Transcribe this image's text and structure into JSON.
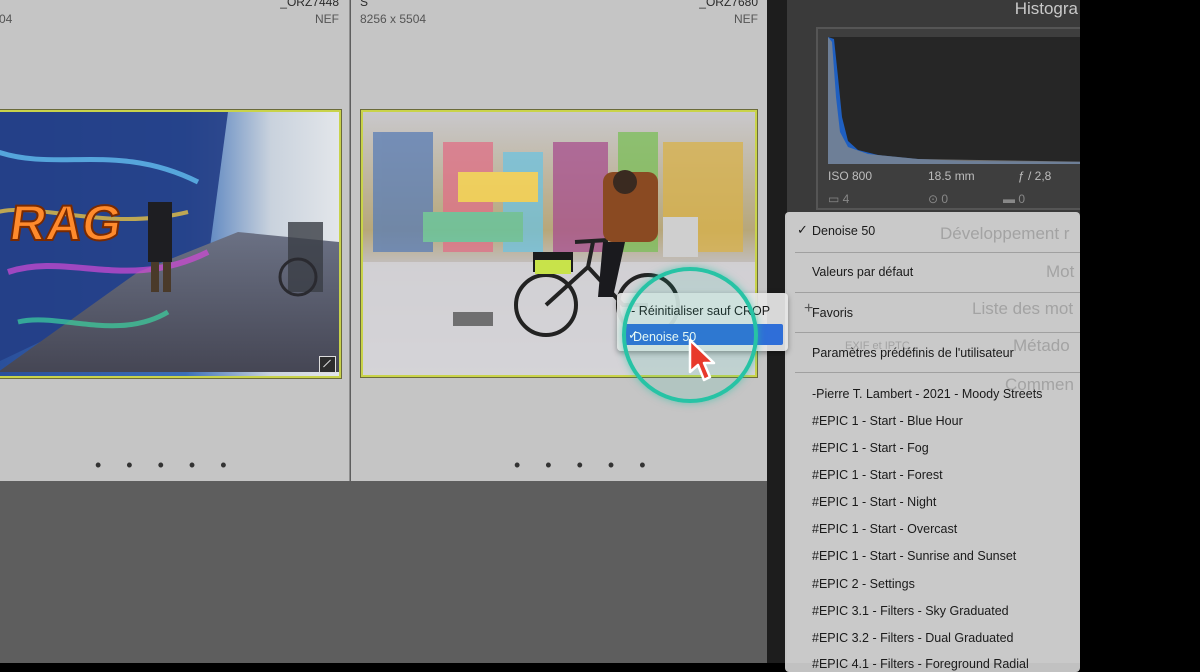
{
  "grid": {
    "cells": [
      {
        "name": "_ORZ7448",
        "format": "NEF",
        "dimensions": "04"
      },
      {
        "name": "_ORZ7680",
        "format": "NEF",
        "dimensions": "8256 x 5504",
        "prefix": "S"
      }
    ],
    "dots": "• • • • •"
  },
  "histogram": {
    "title": "Histogra",
    "iso": "ISO 800",
    "focal": "18.5 mm",
    "aperture": "ƒ / 2,8",
    "counts": [
      "4",
      "0",
      "0"
    ],
    "colors": {
      "blue": "#1f5fc0",
      "gray": "#8a8a8a"
    }
  },
  "panels": {
    "develop": "Développement r",
    "mots": "Mot",
    "liste_mots": "Liste des mot",
    "metadata": "Métado",
    "comments": "Commen",
    "exif_label": "EXIF et IPTC"
  },
  "presets_menu": {
    "selected": "Denoise 50",
    "items": [
      "Valeurs par défaut",
      "Favoris",
      "Paramètres prédéfinis de l'utilisateur",
      "-Pierre T. Lambert - 2021 - Moody Streets",
      "#EPIC 1 - Start - Blue Hour",
      "#EPIC 1 - Start - Fog",
      "#EPIC 1 - Start - Forest",
      "#EPIC 1 - Start - Night",
      "#EPIC 1 - Start - Overcast",
      "#EPIC 1 - Start - Sunrise and Sunset",
      "#EPIC 2 - Settings",
      "#EPIC 3.1 - Filters - Sky Graduated",
      "#EPIC 3.2 - Filters - Dual Graduated",
      "#EPIC 4.1 - Filters - Foreground Radial"
    ]
  },
  "submenu": {
    "reset": "-- Réinitialiser sauf CROP",
    "selected": "Denoise 50"
  },
  "accent": "#27c3a5"
}
